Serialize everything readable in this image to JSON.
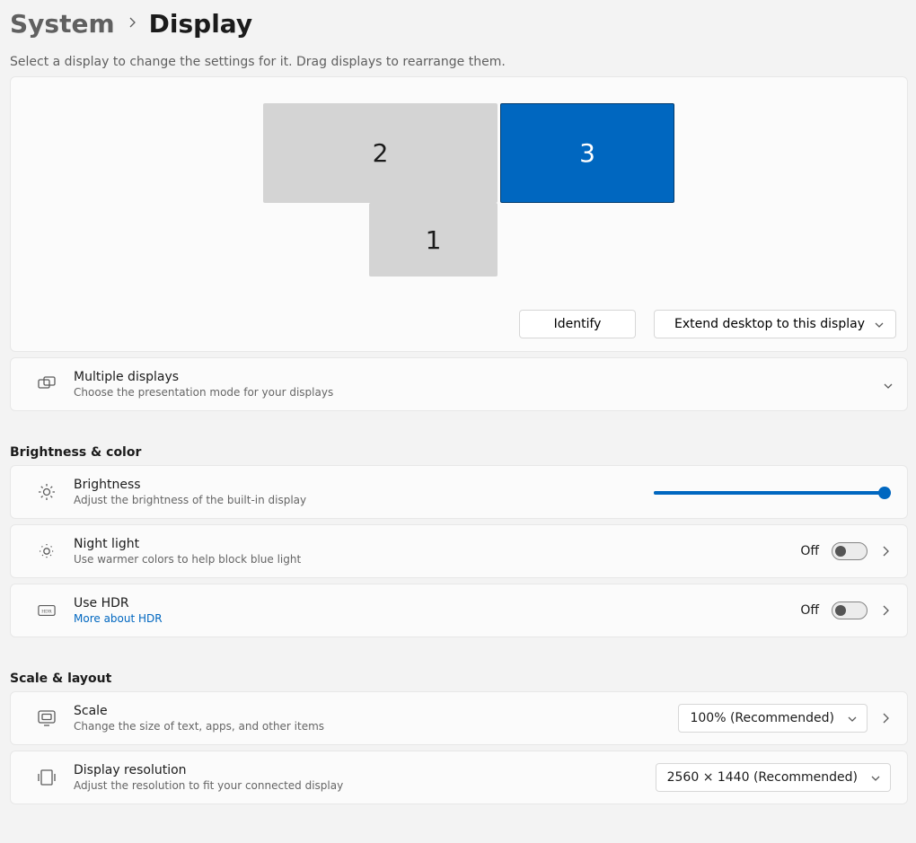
{
  "breadcrumb": {
    "parent": "System",
    "current": "Display"
  },
  "hint": "Select a display to change the settings for it. Drag displays to rearrange them.",
  "monitors": {
    "m1": "1",
    "m2": "2",
    "m3": "3",
    "selected": "3"
  },
  "arrange": {
    "identify": "Identify",
    "mode": "Extend desktop to this display"
  },
  "multiDisplays": {
    "title": "Multiple displays",
    "sub": "Choose the presentation mode for your displays"
  },
  "sections": {
    "brightness": "Brightness & color",
    "scale": "Scale & layout"
  },
  "brightness": {
    "title": "Brightness",
    "sub": "Adjust the brightness of the built-in display",
    "value_pct": 100
  },
  "nightLight": {
    "title": "Night light",
    "sub": "Use warmer colors to help block blue light",
    "state_label": "Off",
    "state": false
  },
  "hdr": {
    "title": "Use HDR",
    "more": "More about HDR",
    "state_label": "Off",
    "state": false
  },
  "scale": {
    "title": "Scale",
    "sub": "Change the size of text, apps, and other items",
    "value": "100% (Recommended)"
  },
  "resolution": {
    "title": "Display resolution",
    "sub": "Adjust the resolution to fit your connected display",
    "value": "2560 × 1440 (Recommended)"
  }
}
